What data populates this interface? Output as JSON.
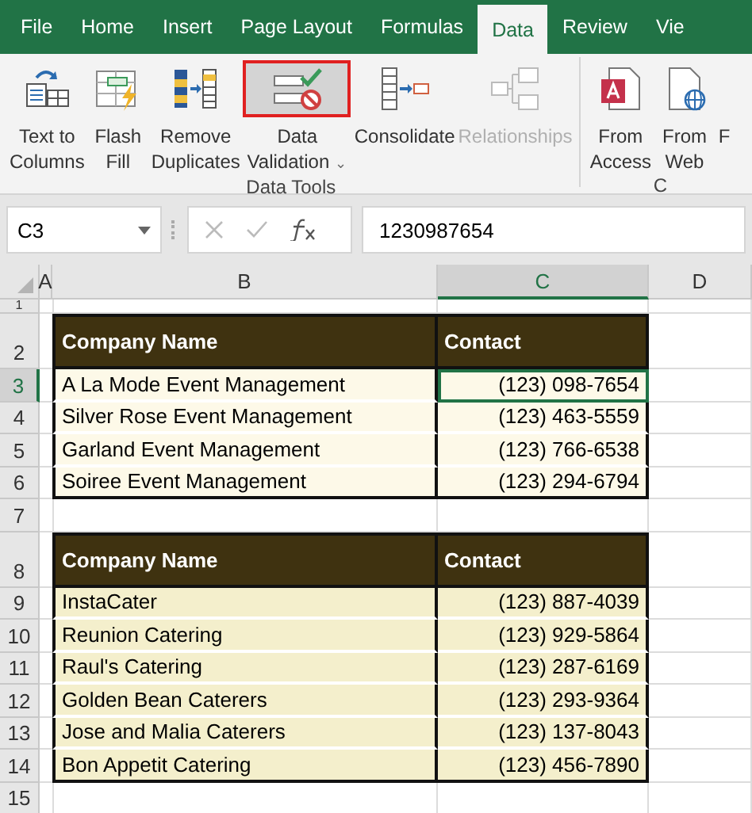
{
  "tabs": [
    {
      "label": "File",
      "selected": false
    },
    {
      "label": "Home",
      "selected": false
    },
    {
      "label": "Insert",
      "selected": false
    },
    {
      "label": "Page Layout",
      "selected": false
    },
    {
      "label": "Formulas",
      "selected": false
    },
    {
      "label": "Data",
      "selected": true
    },
    {
      "label": "Review",
      "selected": false
    },
    {
      "label": "Vie",
      "selected": false
    }
  ],
  "ribbon": {
    "groups": [
      {
        "label": "Data Tools",
        "buttons": [
          {
            "kind": "text-to-columns",
            "lines": [
              "Text to",
              "Columns"
            ],
            "disabled": false,
            "highlighted": false
          },
          {
            "kind": "flash-fill",
            "lines": [
              "Flash",
              "Fill"
            ],
            "disabled": false,
            "highlighted": false
          },
          {
            "kind": "remove-duplicates",
            "lines": [
              "Remove",
              "Duplicates"
            ],
            "disabled": false,
            "highlighted": false
          },
          {
            "kind": "data-validation",
            "lines": [
              "Data",
              "Validation"
            ],
            "disabled": false,
            "highlighted": true,
            "caret": "⌄"
          },
          {
            "kind": "consolidate",
            "lines": [
              "Consolidate"
            ],
            "disabled": false,
            "highlighted": false
          },
          {
            "kind": "relationships",
            "lines": [
              "Relationships"
            ],
            "disabled": true,
            "highlighted": false
          }
        ]
      },
      {
        "label": "C",
        "buttons": [
          {
            "kind": "from-access",
            "lines": [
              "From",
              "Access"
            ],
            "disabled": false,
            "highlighted": false
          },
          {
            "kind": "from-web",
            "lines": [
              "From",
              "Web"
            ],
            "disabled": false,
            "highlighted": false
          },
          {
            "kind": "partial",
            "lines": [
              "F"
            ],
            "disabled": false,
            "highlighted": false
          }
        ]
      }
    ]
  },
  "formula_bar": {
    "name_box": "C3",
    "value": "1230987654"
  },
  "columns": [
    {
      "label": "A",
      "selected": false
    },
    {
      "label": "B",
      "selected": false
    },
    {
      "label": "C",
      "selected": true
    },
    {
      "label": "D",
      "selected": false
    }
  ],
  "rows": [
    {
      "label": "1",
      "kind": "blank",
      "selected": false
    },
    {
      "label": "2",
      "kind": "header",
      "selected": false,
      "cells": [
        "Company Name",
        "Contact"
      ]
    },
    {
      "label": "3",
      "kind": "body",
      "selected": true,
      "cells": [
        "A La Mode Event Management",
        "(123) 098-7654"
      ]
    },
    {
      "label": "4",
      "kind": "body",
      "selected": false,
      "cells": [
        "Silver Rose Event Management",
        "(123) 463-5559"
      ]
    },
    {
      "label": "5",
      "kind": "body",
      "selected": false,
      "cells": [
        "Garland Event Management",
        "(123) 766-6538"
      ]
    },
    {
      "label": "6",
      "kind": "body",
      "selected": false,
      "cells": [
        "Soiree Event Management",
        "(123) 294-6794"
      ]
    },
    {
      "label": "7",
      "kind": "blank",
      "selected": false
    },
    {
      "label": "8",
      "kind": "header",
      "selected": false,
      "cells": [
        "Company Name",
        "Contact"
      ]
    },
    {
      "label": "9",
      "kind": "body",
      "selected": false,
      "cells": [
        "InstaCater",
        "(123) 887-4039"
      ]
    },
    {
      "label": "10",
      "kind": "body",
      "selected": false,
      "cells": [
        "Reunion Catering",
        "(123) 929-5864"
      ]
    },
    {
      "label": "11",
      "kind": "body",
      "selected": false,
      "cells": [
        "Raul's Catering",
        "(123) 287-6169"
      ]
    },
    {
      "label": "12",
      "kind": "body",
      "selected": false,
      "cells": [
        "Golden Bean Caterers",
        "(123) 293-9364"
      ]
    },
    {
      "label": "13",
      "kind": "body",
      "selected": false,
      "cells": [
        "Jose and Malia Caterers",
        "(123) 137-8043"
      ]
    },
    {
      "label": "14",
      "kind": "body",
      "selected": false,
      "cells": [
        "Bon Appetit Catering",
        "(123) 456-7890"
      ]
    },
    {
      "label": "15",
      "kind": "blank",
      "selected": false
    }
  ]
}
